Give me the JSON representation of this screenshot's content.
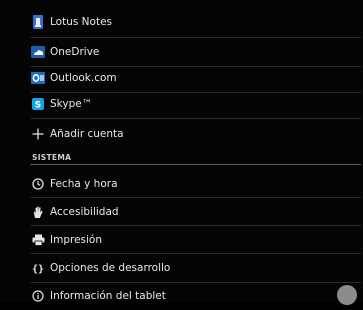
{
  "accounts": {
    "items": [
      {
        "label": "Lotus Notes",
        "icon": "lotus-notes-icon"
      },
      {
        "label": "OneDrive",
        "icon": "onedrive-icon"
      },
      {
        "label": "Outlook.com",
        "icon": "outlook-icon"
      },
      {
        "label": "Skype™",
        "icon": "skype-icon"
      }
    ],
    "add_account_label": "Añadir cuenta"
  },
  "system": {
    "header": "SISTEMA",
    "items": [
      {
        "label": "Fecha y hora",
        "icon": "clock-icon"
      },
      {
        "label": "Accesibilidad",
        "icon": "hand-icon"
      },
      {
        "label": "Impresión",
        "icon": "printer-icon"
      },
      {
        "label": "Opciones de desarrollo",
        "icon": "braces-icon"
      },
      {
        "label": "Información del tablet",
        "icon": "info-icon"
      }
    ]
  },
  "colors": {
    "background": "#050505",
    "onedrive": "#1e5fa8",
    "outlook": "#1b6fc1",
    "skype": "#16a3e0",
    "lotus": "#3a6fcf"
  }
}
